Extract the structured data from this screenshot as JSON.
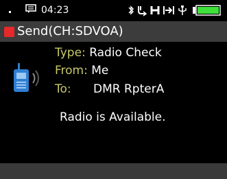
{
  "status": {
    "time": "04:23",
    "icons": [
      "message-icon",
      "bluetooth-icon",
      "gps-icon",
      "h-icon",
      "forward-icon",
      "antenna-icon",
      "battery-icon"
    ],
    "battery_color": "#3ee03a"
  },
  "header": {
    "title": "Send(CH:SDVOA)",
    "accent": "#e8282b"
  },
  "message": {
    "type_label": "Type:",
    "type_value": "Radio Check",
    "from_label": "From:",
    "from_value": "Me",
    "to_label": "To:",
    "to_value": "DMR RpterA",
    "result": "Radio is Available."
  },
  "colors": {
    "label": "#c9c96a",
    "radio_blue": "#2f7fd1"
  }
}
